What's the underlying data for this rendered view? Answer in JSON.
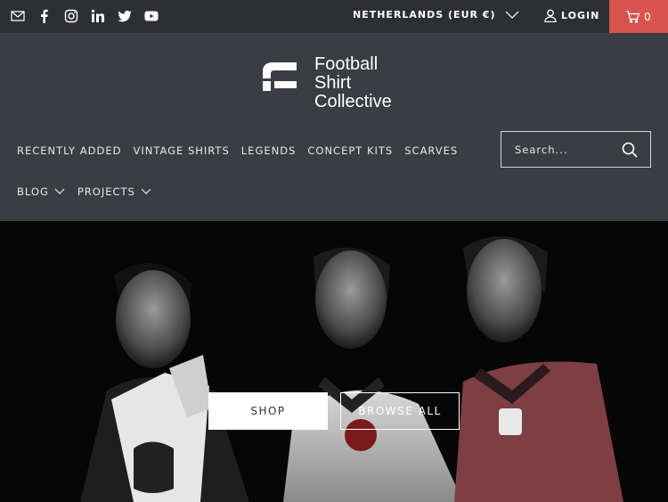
{
  "topbar": {
    "social_icons": [
      "email-icon",
      "facebook-icon",
      "instagram-icon",
      "linkedin-icon",
      "twitter-icon",
      "youtube-icon"
    ],
    "currency_label": "NETHERLANDS (EUR €)",
    "login_label": "LOGIN",
    "cart_count": "0",
    "cart_color": "#d9534f"
  },
  "logo": {
    "line1": "Football",
    "line2": "Shirt",
    "line3": "Collective"
  },
  "nav": {
    "items": [
      {
        "label": "RECENTLY ADDED"
      },
      {
        "label": "VINTAGE SHIRTS"
      },
      {
        "label": "LEGENDS"
      },
      {
        "label": "CONCEPT KITS"
      },
      {
        "label": "SCARVES"
      }
    ],
    "dropdowns": [
      {
        "label": "BLOG"
      },
      {
        "label": "PROJECTS"
      }
    ]
  },
  "search": {
    "placeholder": "Search..."
  },
  "hero": {
    "shop_label": "SHOP",
    "browse_label": "BROWSE ALL"
  },
  "colors": {
    "topbar_bg": "#2d2f33",
    "header_bg": "#3a3d42",
    "accent": "#d9534f"
  }
}
